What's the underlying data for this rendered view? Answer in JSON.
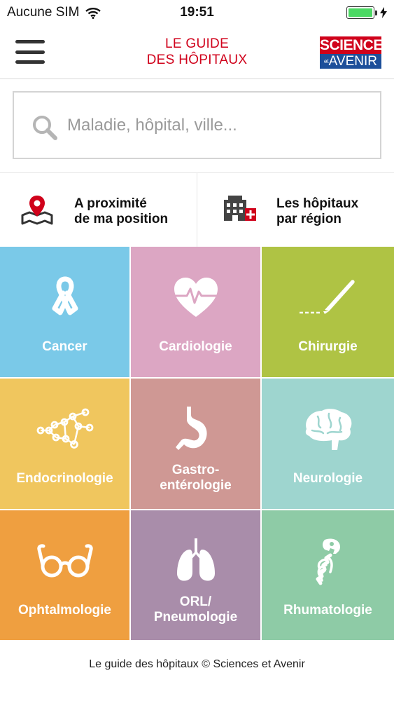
{
  "status_bar": {
    "carrier": "Aucune SIM",
    "time": "19:51"
  },
  "nav": {
    "logo_line1": "Le guide",
    "logo_line2": "des hôpitaux",
    "brand_top": "SCIENCES",
    "brand_bottom": "AVENIR",
    "brand_et": "et"
  },
  "search": {
    "placeholder": "Maladie, hôpital, ville...",
    "value": ""
  },
  "quick_links": [
    {
      "label": "A proximité\nde ma position",
      "icon": "location-map-icon"
    },
    {
      "label": "Les hôpitaux\npar région",
      "icon": "hospital-building-icon"
    }
  ],
  "categories": [
    {
      "label": "Cancer",
      "icon": "ribbon-icon",
      "color": "#7ac9e8"
    },
    {
      "label": "Cardiologie",
      "icon": "heart-pulse-icon",
      "color": "#dca6c3"
    },
    {
      "label": "Chirurgie",
      "icon": "scalpel-icon",
      "color": "#afc344"
    },
    {
      "label": "Endocrinologie",
      "icon": "molecule-icon",
      "color": "#f0c65e"
    },
    {
      "label": "Gastro-\nentérologie",
      "icon": "stomach-icon",
      "color": "#cf9894"
    },
    {
      "label": "Neurologie",
      "icon": "brain-icon",
      "color": "#9ed5cf"
    },
    {
      "label": "Ophtalmologie",
      "icon": "glasses-icon",
      "color": "#ef9f40"
    },
    {
      "label": "ORL/\nPneumologie",
      "icon": "lungs-icon",
      "color": "#a98daa"
    },
    {
      "label": "Rhumatologie",
      "icon": "skeleton-icon",
      "color": "#8ecba6"
    }
  ],
  "footer": {
    "text": "Le guide des hôpitaux © Sciences et Avenir"
  },
  "colors": {
    "accent_red": "#d0021b",
    "brand_blue": "#1d4f9a",
    "battery_green": "#4cd964"
  }
}
